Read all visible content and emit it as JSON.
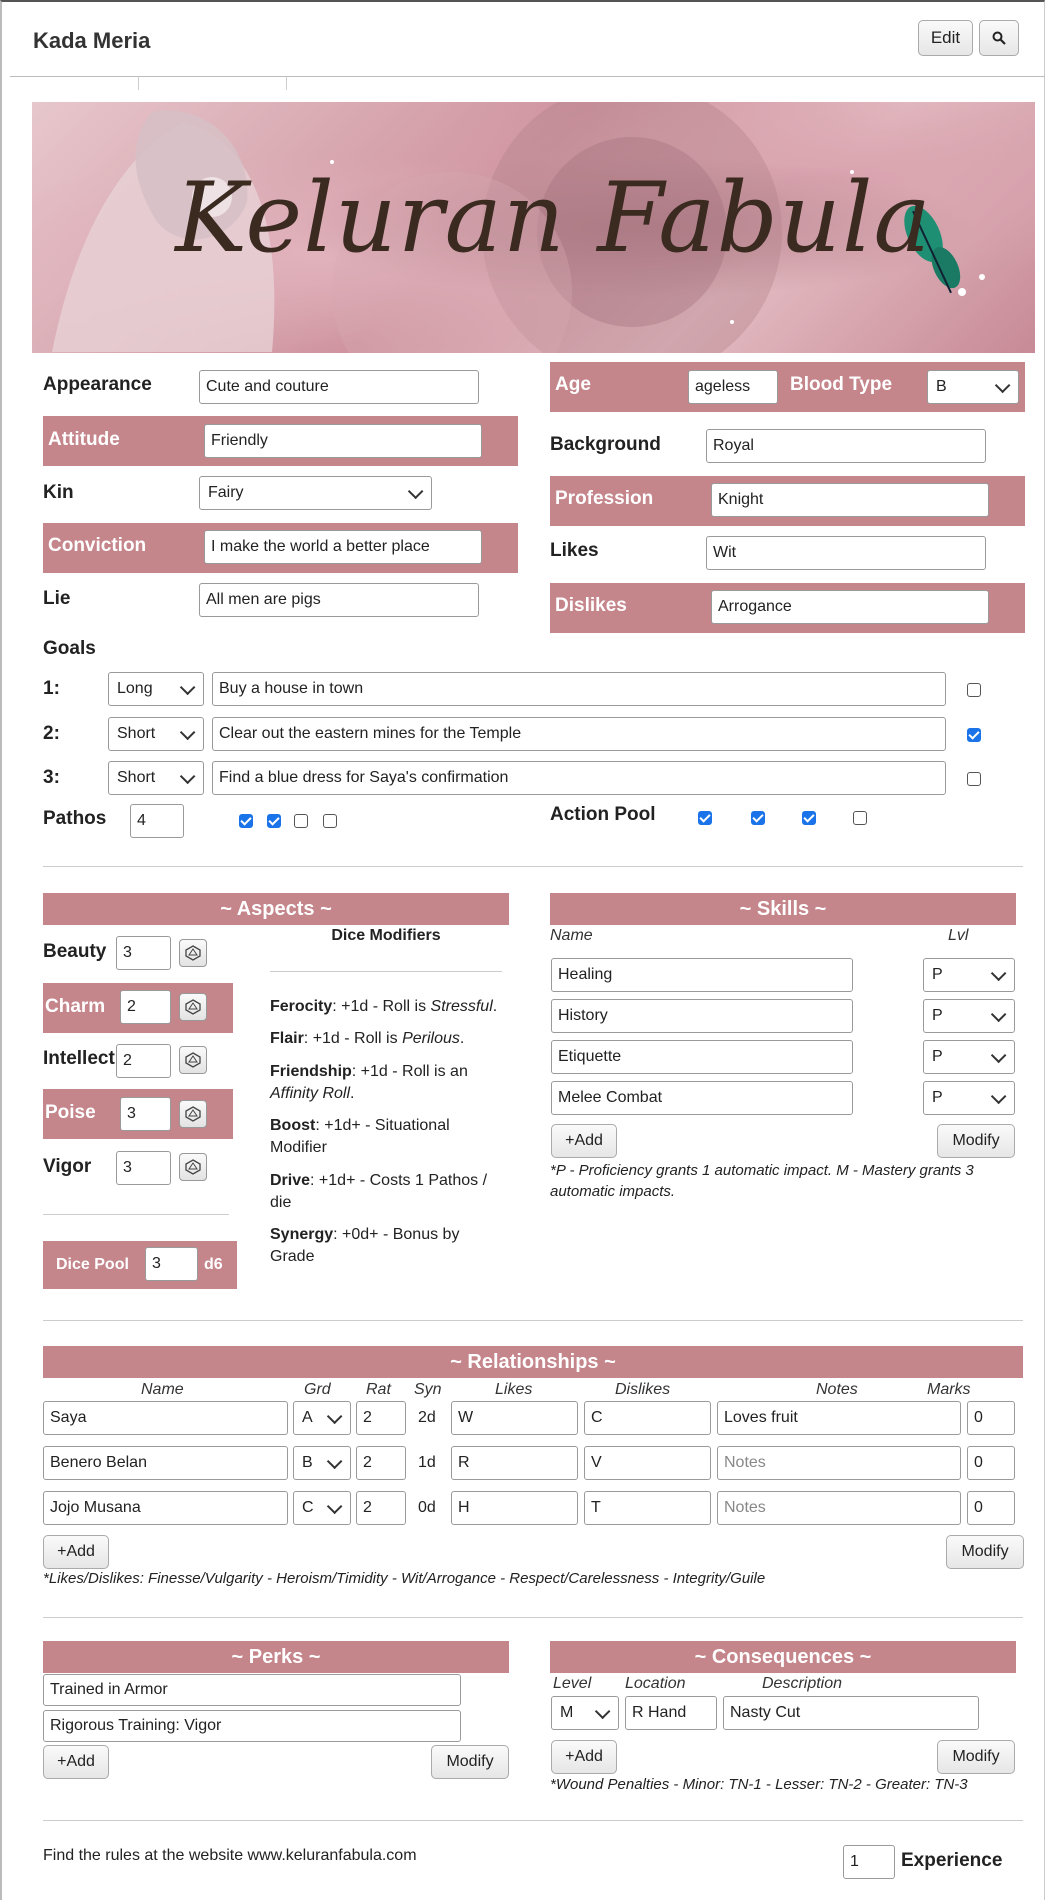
{
  "header": {
    "title": "Kada Meria",
    "edit_label": "Edit"
  },
  "banner": {
    "title": "Keluran Fabula"
  },
  "fields": {
    "appearance_label": "Appearance",
    "appearance": "Cute and couture",
    "attitude_label": "Attitude",
    "attitude": "Friendly",
    "kin_label": "Kin",
    "kin": "Fairy",
    "conviction_label": "Conviction",
    "conviction": "I make the world a better place",
    "lie_label": "Lie",
    "lie": "All men are pigs",
    "age_label": "Age",
    "age": "ageless",
    "blood_type_label": "Blood Type",
    "blood_type": "B",
    "background_label": "Background",
    "background": "Royal",
    "profession_label": "Profession",
    "profession": "Knight",
    "likes_label": "Likes",
    "likes": "Wit",
    "dislikes_label": "Dislikes",
    "dislikes": "Arrogance"
  },
  "goals": {
    "label": "Goals",
    "items": [
      {
        "num": "1:",
        "term": "Long",
        "text": "Buy a house in town",
        "done": false
      },
      {
        "num": "2:",
        "term": "Short",
        "text": "Clear out the eastern mines for the Temple",
        "done": true
      },
      {
        "num": "3:",
        "term": "Short",
        "text": "Find a blue dress for Saya's confirmation",
        "done": false
      }
    ]
  },
  "pathos": {
    "label": "Pathos",
    "value": "4",
    "checks": [
      true,
      true,
      false,
      false
    ]
  },
  "action_pool": {
    "label": "Action Pool",
    "checks": [
      true,
      true,
      true,
      false
    ]
  },
  "aspects": {
    "heading": "~ Aspects ~",
    "items": [
      {
        "label": "Beauty",
        "value": "3"
      },
      {
        "label": "Charm",
        "value": "2"
      },
      {
        "label": "Intellect",
        "value": "2"
      },
      {
        "label": "Poise",
        "value": "3"
      },
      {
        "label": "Vigor",
        "value": "3"
      }
    ],
    "dice_pool_label": "Dice Pool",
    "dice_pool_value": "3",
    "dice_pool_unit": "d6"
  },
  "dice_modifiers": {
    "heading": "Dice Modifiers",
    "items": [
      {
        "name": "Ferocity",
        "text": ": +1d - Roll is ",
        "em": "Stressful",
        "tail": "."
      },
      {
        "name": "Flair",
        "text": ": +1d - Roll is ",
        "em": "Perilous",
        "tail": "."
      },
      {
        "name": "Friendship",
        "text": ": +1d - Roll is an ",
        "em": "Affinity Roll",
        "tail": "."
      },
      {
        "name": "Boost",
        "text": ": +1d+ - Situational Modifier",
        "em": "",
        "tail": ""
      },
      {
        "name": "Drive",
        "text": ": +1d+ - Costs 1 Pathos / die",
        "em": "",
        "tail": ""
      },
      {
        "name": "Synergy",
        "text": ": +0d+ - Bonus by Grade",
        "em": "",
        "tail": ""
      }
    ]
  },
  "skills": {
    "heading": "~ Skills ~",
    "col_name": "Name",
    "col_lvl": "Lvl",
    "items": [
      {
        "name": "Healing",
        "lvl": "P"
      },
      {
        "name": "History",
        "lvl": "P"
      },
      {
        "name": "Etiquette",
        "lvl": "P"
      },
      {
        "name": "Melee Combat",
        "lvl": "P"
      }
    ],
    "add_label": "+Add",
    "modify_label": "Modify",
    "note": "*P - Proficiency grants 1 automatic impact. M - Mastery grants 3 automatic impacts."
  },
  "relationships": {
    "heading": "~ Relationships ~",
    "columns": [
      "Name",
      "Grd",
      "Rat",
      "Syn",
      "Likes",
      "Dislikes",
      "Notes",
      "Marks"
    ],
    "rows": [
      {
        "name": "Saya",
        "grd": "A",
        "rat": "2",
        "syn": "2d",
        "likes": "W",
        "dislikes": "C",
        "notes": "Loves fruit",
        "notes_ph": false,
        "marks": "0"
      },
      {
        "name": "Benero Belan",
        "grd": "B",
        "rat": "2",
        "syn": "1d",
        "likes": "R",
        "dislikes": "V",
        "notes": "Notes",
        "notes_ph": true,
        "marks": "0"
      },
      {
        "name": "Jojo Musana",
        "grd": "C",
        "rat": "2",
        "syn": "0d",
        "likes": "H",
        "dislikes": "T",
        "notes": "Notes",
        "notes_ph": true,
        "marks": "0"
      }
    ],
    "add_label": "+Add",
    "modify_label": "Modify",
    "note": "*Likes/Dislikes: Finesse/Vulgarity - Heroism/Timidity - Wit/Arrogance - Respect/Carelessness - Integrity/Guile"
  },
  "perks": {
    "heading": "~ Perks ~",
    "items": [
      "Trained in Armor",
      "Rigorous Training: Vigor"
    ],
    "add_label": "+Add",
    "modify_label": "Modify"
  },
  "consequences": {
    "heading": "~ Consequences ~",
    "col_level": "Level",
    "col_location": "Location",
    "col_description": "Description",
    "items": [
      {
        "level": "M",
        "location": "R Hand",
        "description": "Nasty Cut"
      }
    ],
    "add_label": "+Add",
    "modify_label": "Modify",
    "note": "*Wound Penalties - Minor: TN-1 - Lesser: TN-2 - Greater: TN-3"
  },
  "footer": {
    "rules_text": "Find the rules at the website www.keluranfabula.com",
    "experience_value": "1",
    "experience_label": "Experience"
  },
  "colors": {
    "accent": "#c4858b",
    "checkbox": "#1a73e8"
  }
}
